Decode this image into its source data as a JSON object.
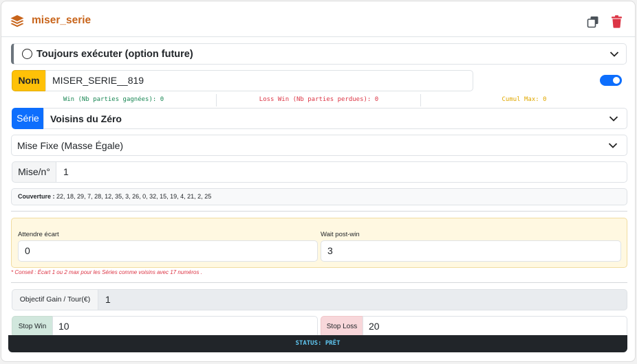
{
  "header": {
    "title": "miser_serie",
    "logo_icon": "layer-group-icon",
    "copy_icon": "copy-icon",
    "delete_icon": "trash-icon",
    "accent_color": "#c8641a",
    "delete_color": "#dc3545"
  },
  "always_execute": {
    "label": "Toujours exécuter (option future)",
    "checked": false
  },
  "name": {
    "label": "Nom",
    "value": "MISER_SERIE__819",
    "toggle_on": true
  },
  "stats": {
    "win": "Win (Nb parties gagnées): 0",
    "loss": "Loss Win (Nb parties perdues): 0",
    "cumul": "Cumul Max: 0"
  },
  "serie": {
    "label": "Série",
    "selected": "Voisins du Zéro"
  },
  "mise_mode": {
    "selected": "Mise Fixe (Masse Égale)"
  },
  "mise_par_numero": {
    "label": "Mise/n°",
    "value": "1"
  },
  "couverture": {
    "label": "Couverture :",
    "value": "22, 18, 29, 7, 28, 12, 35, 3, 26, 0, 32, 15, 19, 4, 21, 2, 25"
  },
  "attente": {
    "ecart_label": "Attendre écart",
    "ecart_value": "0",
    "postwin_label": "Wait post-win",
    "postwin_value": "3"
  },
  "conseil": "* Conseil : Écart 1 ou 2 max pour les Séries comme voisins avec 17 numéros .",
  "objectif": {
    "label": "Objectif Gain / Tour(€)",
    "value": "1"
  },
  "stops": {
    "win_label": "Stop Win",
    "win_value": "10",
    "loss_label": "Stop Loss",
    "loss_value": "20"
  },
  "status": "STATUS: PRÊT"
}
